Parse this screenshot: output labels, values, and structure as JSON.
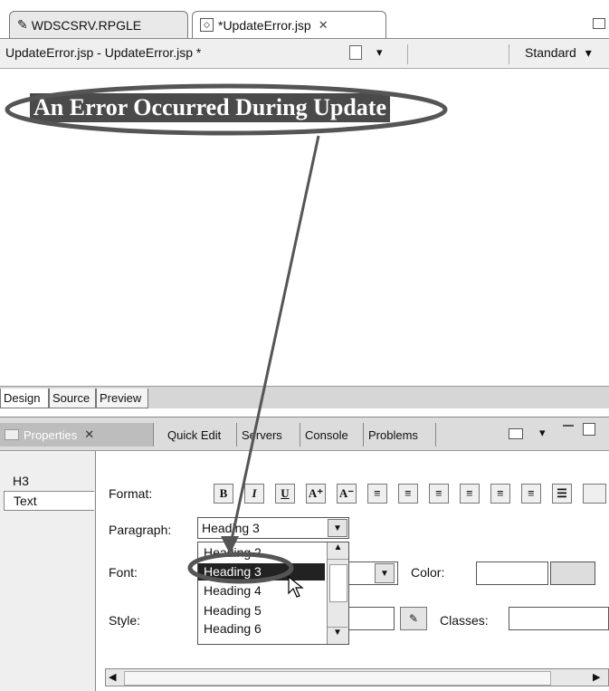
{
  "editor_tabs": [
    {
      "label": "WDSCSRV.RPGLE",
      "icon": "pencil-icon"
    },
    {
      "label": "*UpdateError.jsp",
      "icon": "jsp-file-icon",
      "close_glyph": "✕"
    }
  ],
  "toolbar": {
    "title": "UpdateError.jsp - UpdateError.jsp *",
    "mode_label": "Standard",
    "dropdown_glyph": "▾"
  },
  "canvas": {
    "heading_text": "An Error Occurred During Update"
  },
  "bottom_tabs": [
    {
      "label": "Design"
    },
    {
      "label": "Source"
    },
    {
      "label": "Preview"
    }
  ],
  "panel_tabs": [
    {
      "label": "Properties",
      "close_glyph": "✕"
    },
    {
      "label": "Quick Edit"
    },
    {
      "label": "Servers"
    },
    {
      "label": "Console"
    },
    {
      "label": "Problems"
    }
  ],
  "side_tabs": [
    {
      "label": "H3"
    },
    {
      "label": "Text"
    }
  ],
  "format": {
    "label": "Format:",
    "buttons": [
      "B",
      "I",
      "U",
      "A⁺",
      "A⁻",
      "",
      "",
      "",
      "",
      "",
      "",
      ""
    ]
  },
  "paragraph": {
    "label": "Paragraph:",
    "value": "Heading 3",
    "options": [
      "Heading 2",
      "Heading 3",
      "Heading 4",
      "Heading 5",
      "Heading 6"
    ],
    "selected_index": 1
  },
  "font": {
    "label": "Font:",
    "value": ""
  },
  "color": {
    "label": "Color:"
  },
  "style": {
    "label": "Style:",
    "value": ""
  },
  "classes": {
    "label": "Classes:",
    "value": ""
  },
  "colors": {
    "annotation": "#555555",
    "selection": "#222222"
  }
}
